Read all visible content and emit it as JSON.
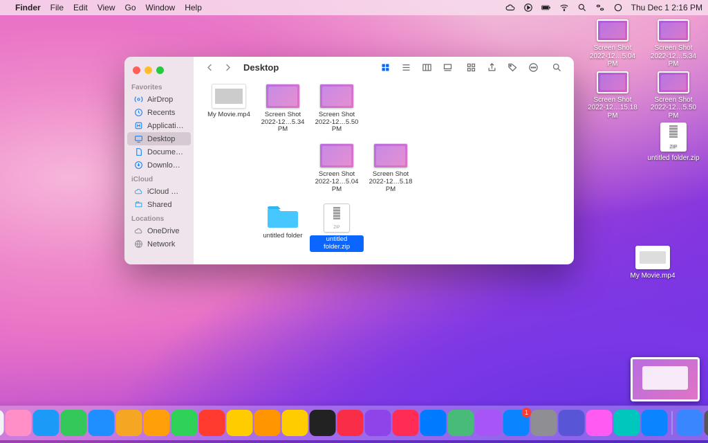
{
  "menubar": {
    "app": "Finder",
    "items": [
      "File",
      "Edit",
      "View",
      "Go",
      "Window",
      "Help"
    ],
    "clock": "Thu Dec 1  2:16 PM"
  },
  "desktop_icons": [
    {
      "name": "Screen Shot",
      "sub": "2022-12…5.04 PM",
      "kind": "ss"
    },
    {
      "name": "Screen Shot",
      "sub": "2022-12…5.34 PM",
      "kind": "ss"
    },
    {
      "name": "Screen Shot",
      "sub": "2022-12…15.18 PM",
      "kind": "ss"
    },
    {
      "name": "Screen Shot",
      "sub": "2022-12…5.50 PM",
      "kind": "ss"
    },
    {
      "name": "untitled folder.zip",
      "sub": "",
      "kind": "zip"
    }
  ],
  "desktop_movie": {
    "name": "My Movie.mp4"
  },
  "finder": {
    "title": "Desktop",
    "sidebar": {
      "favorites_label": "Favorites",
      "favorites": [
        {
          "icon": "airdrop",
          "label": "AirDrop"
        },
        {
          "icon": "recents",
          "label": "Recents"
        },
        {
          "icon": "apps",
          "label": "Applications"
        },
        {
          "icon": "desktop",
          "label": "Desktop",
          "active": true
        },
        {
          "icon": "documents",
          "label": "Documents"
        },
        {
          "icon": "downloads",
          "label": "Downloads"
        }
      ],
      "icloud_label": "iCloud",
      "icloud": [
        {
          "icon": "icloud",
          "label": "iCloud Drive"
        },
        {
          "icon": "shared",
          "label": "Shared"
        }
      ],
      "locations_label": "Locations",
      "locations": [
        {
          "icon": "onedrive",
          "label": "OneDrive"
        },
        {
          "icon": "network",
          "label": "Network"
        }
      ]
    },
    "items": [
      {
        "label": "My Movie.mp4",
        "sub": "",
        "kind": "movie"
      },
      {
        "label": "Screen Shot",
        "sub": "2022-12…5.34 PM",
        "kind": "ss"
      },
      {
        "label": "Screen Shot",
        "sub": "2022-12…5.50 PM",
        "kind": "ss"
      },
      {
        "label": "Screen Shot",
        "sub": "2022-12…5.04 PM",
        "kind": "ss"
      },
      {
        "label": "Screen Shot",
        "sub": "2022-12…5.18 PM",
        "kind": "ss"
      },
      {
        "label": "untitled folder",
        "sub": "",
        "kind": "folder"
      },
      {
        "label": "untitled folder.zip",
        "sub": "",
        "kind": "zip",
        "selected": true
      }
    ]
  },
  "dock": {
    "apps": [
      {
        "c": "#f2f2f7",
        "n": "finder"
      },
      {
        "c": "#ff8fc6",
        "n": "launchpad"
      },
      {
        "c": "#1b9af7",
        "n": "safari"
      },
      {
        "c": "#34c759",
        "n": "messages"
      },
      {
        "c": "#1f8fff",
        "n": "mail"
      },
      {
        "c": "#f5a623",
        "n": "maps"
      },
      {
        "c": "#ff9f0a",
        "n": "photos"
      },
      {
        "c": "#30d158",
        "n": "facetime"
      },
      {
        "c": "#ff3b30",
        "n": "calendar"
      },
      {
        "c": "#ffcc00",
        "n": "contacts"
      },
      {
        "c": "#ff9500",
        "n": "reminders"
      },
      {
        "c": "#ffcc00",
        "n": "notes"
      },
      {
        "c": "#222",
        "n": "tv"
      },
      {
        "c": "#fa2d48",
        "n": "music"
      },
      {
        "c": "#8e44e8",
        "n": "podcasts"
      },
      {
        "c": "#ff2d55",
        "n": "news"
      },
      {
        "c": "#007aff",
        "n": "appstore-mini"
      },
      {
        "c": "#48bb78",
        "n": "numbers"
      },
      {
        "c": "#a855f7",
        "n": "preview"
      },
      {
        "c": "#0a84ff",
        "n": "appstore",
        "badge": "1"
      },
      {
        "c": "#8e8e93",
        "n": "settings"
      },
      {
        "c": "#5856d6",
        "n": "extra1"
      },
      {
        "c": "#ff5af2",
        "n": "extra2"
      },
      {
        "c": "#00c7be",
        "n": "extra3"
      },
      {
        "c": "#0a84ff",
        "n": "extra4"
      }
    ],
    "tray": [
      {
        "c": "#3a86ff",
        "n": "downloads"
      },
      {
        "c": "#555",
        "n": "trash"
      }
    ]
  }
}
